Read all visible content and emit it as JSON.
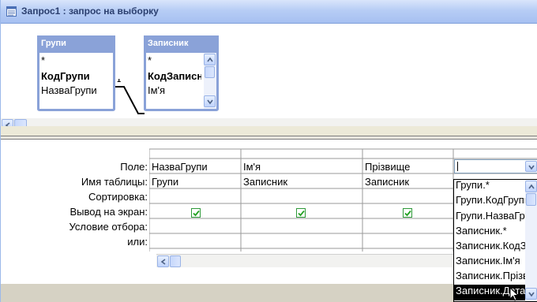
{
  "window": {
    "title": "Запрос1 : запрос на выборку"
  },
  "tables": [
    {
      "title": "Групи",
      "fields": [
        "*",
        "КодГрупи",
        "НазваГрупи"
      ],
      "key_field": "КодГрупи"
    },
    {
      "title": "Записник",
      "fields": [
        "*",
        "КодЗаписника",
        "Ім'я"
      ],
      "key_field": "КодЗаписника"
    }
  ],
  "relationship": {
    "one_side": "1",
    "many_side": "∞"
  },
  "grid": {
    "row_labels": [
      "Поле:",
      "Имя таблицы:",
      "Сортировка:",
      "Вывод на экран:",
      "Условие отбора:",
      "или:"
    ],
    "columns": [
      {
        "field": "НазваГрупи",
        "table": "Групи",
        "sort": "",
        "show": true,
        "criteria": "",
        "or": ""
      },
      {
        "field": "Ім'я",
        "table": "Записник",
        "sort": "",
        "show": true,
        "criteria": "",
        "or": ""
      },
      {
        "field": "Прізвище",
        "table": "Записник",
        "sort": "",
        "show": true,
        "criteria": "",
        "or": ""
      },
      {
        "field": "",
        "table": "",
        "sort": "",
        "show": false,
        "criteria": "",
        "or": ""
      }
    ]
  },
  "dropdown": {
    "items": [
      "Групи.*",
      "Групи.КодГрупи",
      "Групи.НазваГрупи",
      "Записник.*",
      "Записник.КодЗаписника",
      "Записник.Ім'я",
      "Записник.Прізвище",
      "Записник.Дата"
    ],
    "selected_index": 7
  },
  "colors": {
    "field_list_header": "#8aa2d8",
    "titlebar_text": "#2b3f6f",
    "checkbox_border": "#2f9a3a",
    "checkmark": "#21a121"
  },
  "icons": {
    "app": "query-window-icon",
    "scroll_up": "arrow-up-icon",
    "scroll_down": "arrow-down-icon",
    "scroll_left": "arrow-left-icon",
    "dropdown": "chevron-down-icon",
    "checkbox": "checkmark-icon",
    "cursor": "mouse-pointer-icon"
  }
}
